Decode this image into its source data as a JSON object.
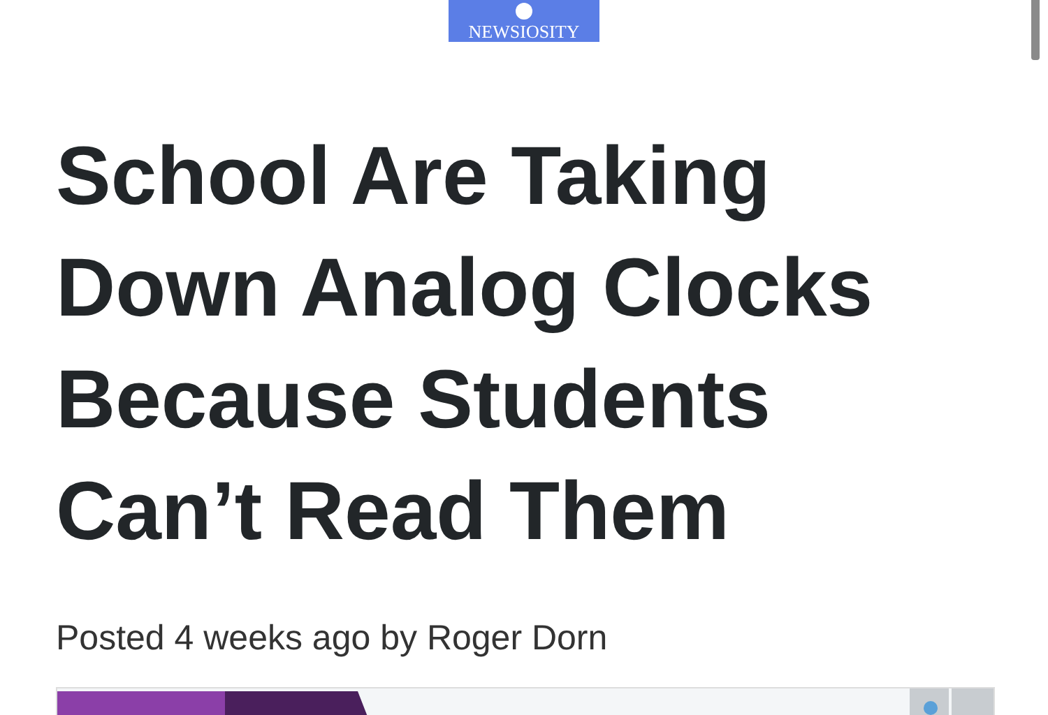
{
  "logo": {
    "text": "NEWSIOSITY"
  },
  "article": {
    "headline_lines": [
      "School Are Taking",
      "Down Analog Clocks",
      "Because Students",
      "Can’t Read Them"
    ],
    "byline": "Posted 4 weeks ago by Roger Dorn"
  }
}
